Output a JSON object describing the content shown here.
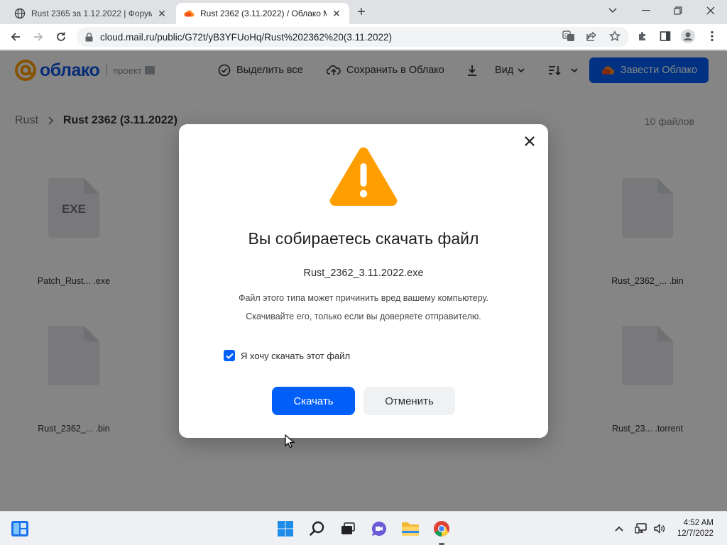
{
  "browser": {
    "tabs": [
      {
        "title": "Rust 2365 за 1.12.2022 | Форум г",
        "active": false,
        "favicon": "globe-icon"
      },
      {
        "title": "Rust 2362 (3.11.2022) / Облако М",
        "active": true,
        "favicon": "cloud-orange-icon"
      }
    ],
    "url": "cloud.mail.ru/public/G72t/yB3YFUoHq/Rust%202362%20(3.11.2022)"
  },
  "app": {
    "logo_text": "облако",
    "logo_suffix": "проект",
    "header_buttons": {
      "select_all": "Выделить все",
      "save_to_cloud": "Сохранить в Облако",
      "view": "Вид",
      "cta": "Завести Облако"
    },
    "breadcrumb": {
      "root": "Rust",
      "current": "Rust 2362 (3.11.2022)"
    },
    "file_count": "10 файлов",
    "files": [
      {
        "name": "Patch_Rust... .exe",
        "ext": "EXE"
      },
      {
        "name": "Rust_2362_... .bin",
        "ext": ""
      },
      {
        "name": "Rust_2362_... .bin",
        "ext": ""
      },
      {
        "name": "Rust_23... .torrent",
        "ext": ""
      }
    ]
  },
  "modal": {
    "title": "Вы собираетесь скачать файл",
    "filename": "Rust_2362_3.11.2022.exe",
    "warning_line1": "Файл этого типа может причинить вред вашему компьютеру.",
    "warning_line2": "Скачивайте его, только если вы доверяете отправителю.",
    "checkbox_label": "Я хочу скачать этот файл",
    "checkbox_checked": true,
    "download_label": "Скачать",
    "cancel_label": "Отменить"
  },
  "taskbar": {
    "time": "4:52 AM",
    "date": "12/7/2022"
  },
  "colors": {
    "accent": "#005ff9",
    "warning": "#ff9e00",
    "logo_at": "#ff9e00"
  }
}
